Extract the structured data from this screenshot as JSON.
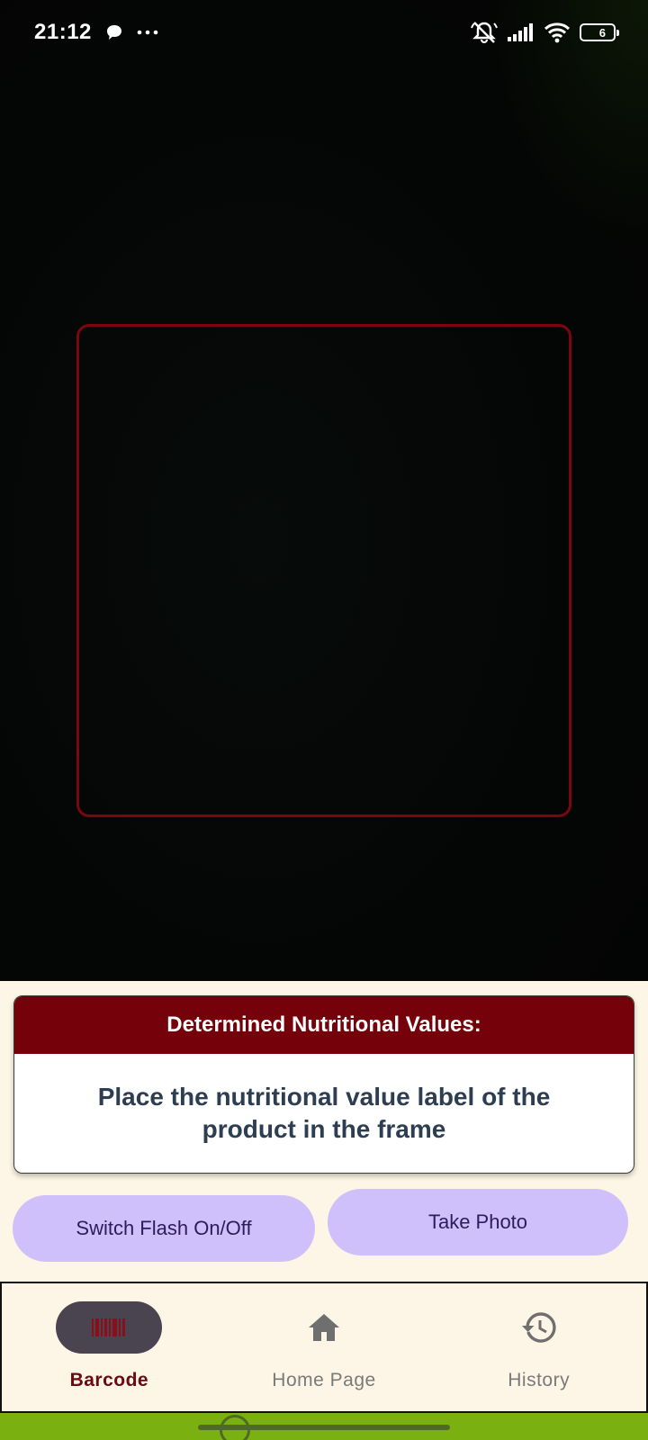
{
  "status_bar": {
    "time": "21:12",
    "battery_level": "6",
    "icons": [
      "chat-bubble-icon",
      "more-dots-icon",
      "mute-icon",
      "signal-icon",
      "wifi-icon",
      "battery-icon"
    ]
  },
  "camera": {
    "frame_color": "#7a0710"
  },
  "result_card": {
    "title": "Determined Nutritional Values:",
    "message": "Place the nutritional value label of the product in the frame",
    "header_color": "#75020b"
  },
  "actions": {
    "flash_label": "Switch Flash On/Off",
    "photo_label": "Take Photo",
    "button_color": "#cfc0fb"
  },
  "bottom_nav": {
    "items": [
      {
        "label": "Barcode",
        "icon": "barcode-icon",
        "active": true
      },
      {
        "label": "Home Page",
        "icon": "home-icon",
        "active": false
      },
      {
        "label": "History",
        "icon": "history-icon",
        "active": false
      }
    ],
    "active_color": "#6a0a12"
  }
}
